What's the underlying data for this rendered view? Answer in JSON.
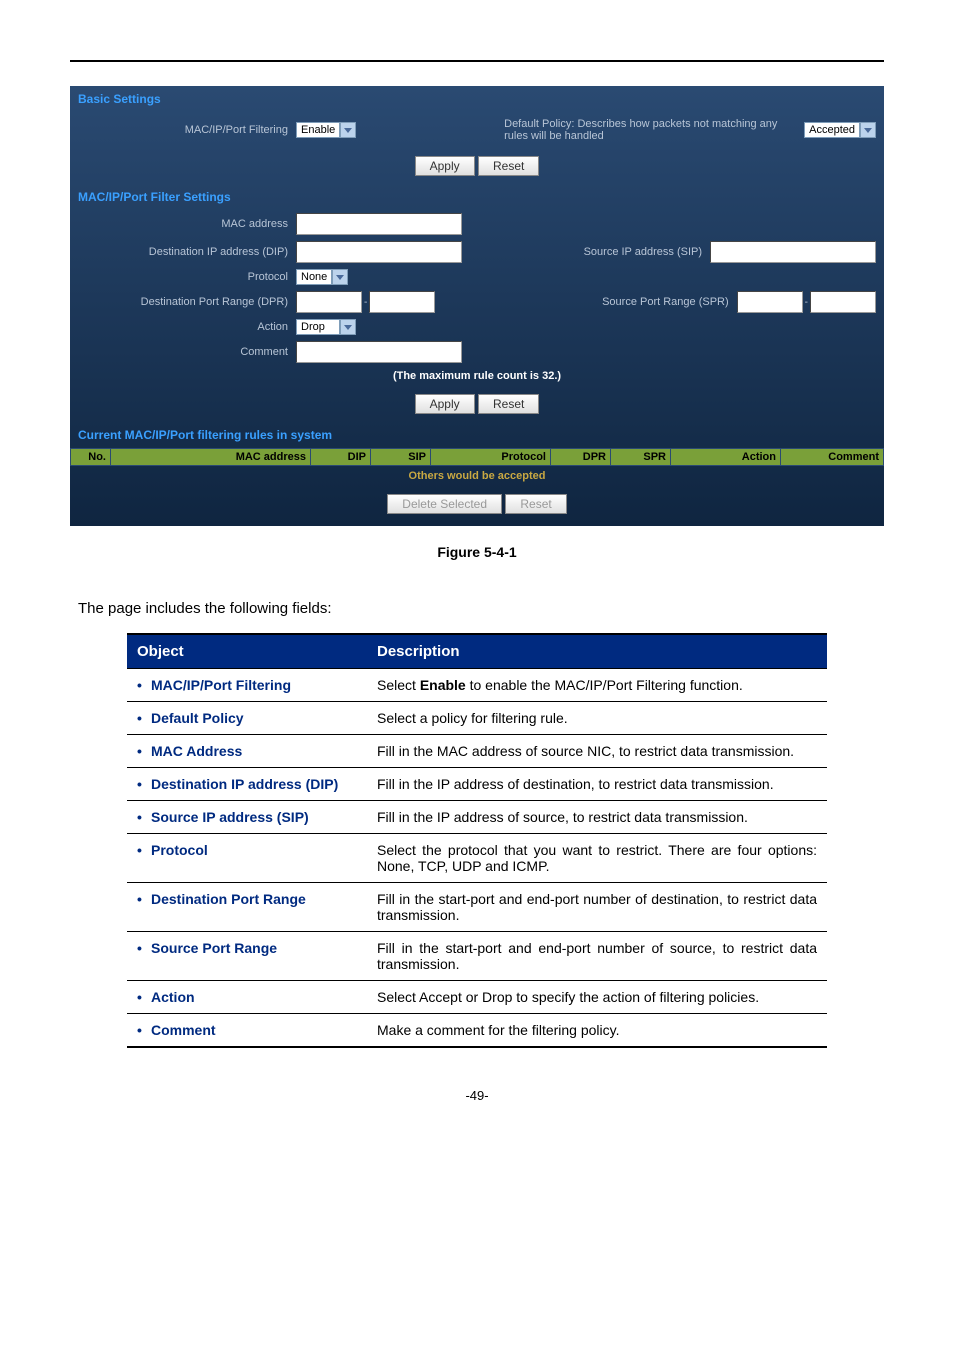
{
  "panel": {
    "basic_title": "Basic Settings",
    "filtering_label": "MAC/IP/Port Filtering",
    "filtering_value": "Enable",
    "policy_label": "Default Policy: Describes how packets not matching any rules will be handled",
    "policy_value": "Accepted",
    "apply": "Apply",
    "reset": "Reset",
    "filter_title": "MAC/IP/Port Filter Settings",
    "mac_label": "MAC address",
    "dip_label": "Destination IP address (DIP)",
    "sip_label": "Source IP address (SIP)",
    "protocol_label": "Protocol",
    "protocol_value": "None",
    "dpr_label": "Destination Port Range (DPR)",
    "spr_label": "Source Port Range (SPR)",
    "action_label": "Action",
    "action_value": "Drop",
    "comment_label": "Comment",
    "max_note": "(The maximum rule count is 32.)",
    "rules_title": "Current MAC/IP/Port filtering rules in system",
    "rules_cols": {
      "no": "No.",
      "mac": "MAC address",
      "dip": "DIP",
      "sip": "SIP",
      "proto": "Protocol",
      "dpr": "DPR",
      "spr": "SPR",
      "action": "Action",
      "comment": "Comment"
    },
    "others": "Others would be accepted",
    "delete": "Delete Selected"
  },
  "figure_caption": "Figure 5-4-1",
  "intro": "The page includes the following fields:",
  "table": {
    "h1": "Object",
    "h2": "Description",
    "rows": [
      {
        "obj": "MAC/IP/Port Filtering",
        "desc_pre": "Select ",
        "desc_b": "Enable",
        "desc_post": " to enable the MAC/IP/Port Filtering function."
      },
      {
        "obj": "Default Policy",
        "desc": "Select a policy for filtering rule."
      },
      {
        "obj": "MAC Address",
        "desc": "Fill in the MAC address of source NIC, to restrict data transmission."
      },
      {
        "obj": "Destination IP address (DIP)",
        "desc": "Fill in the IP address of destination, to restrict data transmission."
      },
      {
        "obj": "Source IP address (SIP)",
        "desc": "Fill in the IP address of source, to restrict data transmission."
      },
      {
        "obj": "Protocol",
        "desc": "Select the protocol that you want to restrict. There are four options: None, TCP, UDP and ICMP."
      },
      {
        "obj": "Destination Port Range",
        "desc": "Fill in the start-port and end-port number of destination, to restrict data transmission."
      },
      {
        "obj": "Source Port Range",
        "desc": "Fill in the start-port and end-port number of source, to restrict data transmission."
      },
      {
        "obj": "Action",
        "desc": "Select Accept or Drop to specify the action of filtering policies."
      },
      {
        "obj": "Comment",
        "desc": "Make a comment for the filtering policy."
      }
    ]
  },
  "footer": "-49-"
}
